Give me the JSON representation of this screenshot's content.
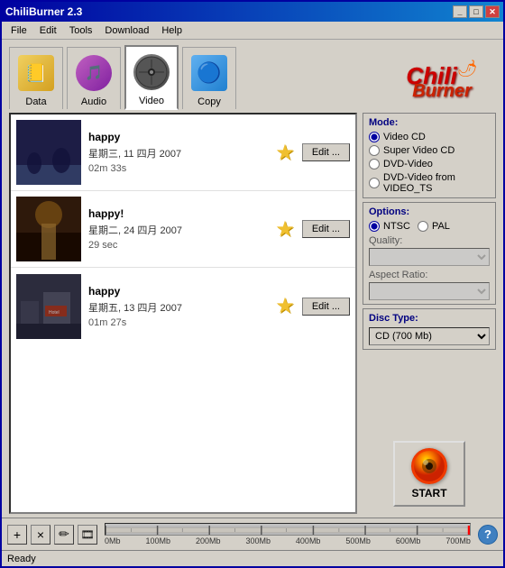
{
  "window": {
    "title": "ChiliBurner 2.3"
  },
  "menu": {
    "items": [
      {
        "label": "File"
      },
      {
        "label": "Edit"
      },
      {
        "label": "Tools"
      },
      {
        "label": "Download"
      },
      {
        "label": "Help"
      }
    ]
  },
  "tabs": [
    {
      "label": "Data",
      "active": false
    },
    {
      "label": "Audio",
      "active": false
    },
    {
      "label": "Video",
      "active": true
    },
    {
      "label": "Copy",
      "active": false
    }
  ],
  "brand": {
    "name": "Chili",
    "subtitle": "Burner"
  },
  "videos": [
    {
      "title": "happy",
      "date": "星期三, 11 四月 2007",
      "duration": "02m 33s",
      "edit_label": "Edit ..."
    },
    {
      "title": "happy!",
      "date": "星期二, 24 四月 2007",
      "duration": "29 sec",
      "edit_label": "Edit ..."
    },
    {
      "title": "happy",
      "date": "星期五, 13 四月 2007",
      "duration": "01m 27s",
      "edit_label": "Edit ..."
    }
  ],
  "mode": {
    "title": "Mode:",
    "options": [
      {
        "label": "Video CD",
        "checked": true
      },
      {
        "label": "Super Video CD",
        "checked": false
      },
      {
        "label": "DVD-Video",
        "checked": false
      },
      {
        "label": "DVD-Video from VIDEO_TS",
        "checked": false
      }
    ]
  },
  "options": {
    "title": "Options:",
    "ntsc_label": "NTSC",
    "pal_label": "PAL",
    "quality_label": "Quality:",
    "aspect_label": "Aspect Ratio:"
  },
  "disc": {
    "label": "Disc Type:",
    "value": "CD (700 Mb)"
  },
  "start_button": {
    "label": "START"
  },
  "bottom": {
    "add_label": "+",
    "delete_label": "×",
    "edit_label": "✏",
    "film_label": "🎞",
    "help_label": "?"
  },
  "progress_labels": [
    "0Mb",
    "100Mb",
    "200Mb",
    "300Mb",
    "400Mb",
    "500Mb",
    "600Mb",
    "700Mb"
  ],
  "status": {
    "text": "Ready"
  }
}
